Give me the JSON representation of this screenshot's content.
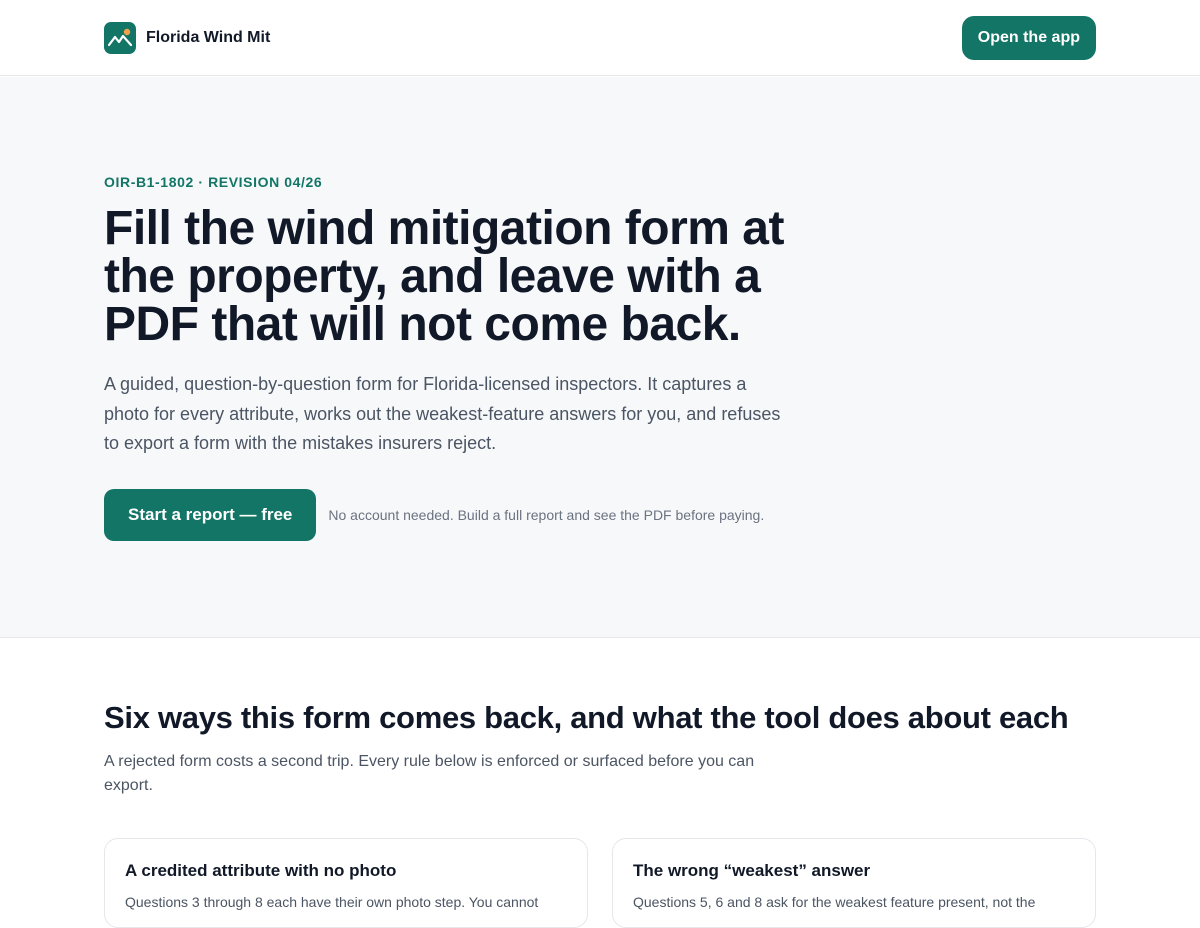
{
  "header": {
    "brand_name": "Florida Wind Mit",
    "logo_icon": "mountain-sun-logo-icon",
    "open_app_label": "Open the app"
  },
  "hero": {
    "eyebrow": "OIR-B1-1802 · REVISION 04/26",
    "title": "Fill the wind mitigation form at the property, and leave with a PDF that will not come back.",
    "subtitle": "A guided, question-by-question form for Florida-licensed inspectors. It captures a photo for every attribute, works out the weakest-feature answers for you, and refuses to export a form with the mistakes insurers reject.",
    "cta_label": "Start a report — free",
    "cta_note": "No account needed. Build a full report and see the PDF before paying."
  },
  "problems": {
    "title": "Six ways this form comes back, and what the tool does about each",
    "subtitle": "A rejected form costs a second trip. Every rule below is enforced or surfaced before you can export.",
    "cards": [
      {
        "title": "A credited attribute with no photo",
        "body": "Questions 3 through 8 each have their own photo step. You cannot"
      },
      {
        "title": "The wrong “weakest” answer",
        "body": "Questions 5, 6 and 8 ask for the weakest feature present, not the"
      }
    ]
  },
  "colors": {
    "brand": "#127566",
    "hero_background": "#f7f8fa",
    "text_primary": "#111827",
    "text_secondary": "#4b5563"
  }
}
